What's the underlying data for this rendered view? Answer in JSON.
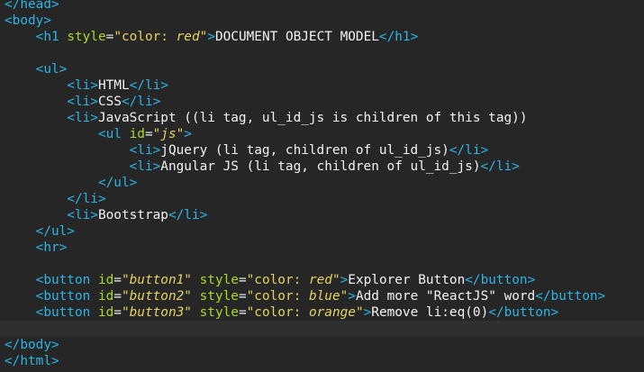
{
  "editor": {
    "colors": {
      "background": "#262626",
      "tag": "#2ab5e6",
      "attribute": "#a8dc24",
      "string": "#e5d35c",
      "text": "#f4f4f4",
      "current_line": "#2f2f2f"
    },
    "lines": [
      {
        "indent": "",
        "parts": [
          {
            "t": "tag",
            "v": "</head>"
          }
        ]
      },
      {
        "indent": "",
        "parts": [
          {
            "t": "tag",
            "v": "<body>"
          }
        ]
      },
      {
        "indent": "    ",
        "parts": [
          {
            "t": "tag",
            "v": "<h1 "
          },
          {
            "t": "attr",
            "v": "style"
          },
          {
            "t": "txt",
            "v": "="
          },
          {
            "t": "val",
            "v": "\"color: "
          },
          {
            "t": "valtext",
            "v": "red"
          },
          {
            "t": "val",
            "v": "\""
          },
          {
            "t": "tag",
            "v": ">"
          },
          {
            "t": "txt",
            "v": "DOCUMENT OBJECT MODEL"
          },
          {
            "t": "tag",
            "v": "</h1>"
          }
        ]
      },
      {
        "indent": "",
        "parts": []
      },
      {
        "indent": "    ",
        "parts": [
          {
            "t": "tag",
            "v": "<ul>"
          }
        ]
      },
      {
        "indent": "        ",
        "parts": [
          {
            "t": "tag",
            "v": "<li>"
          },
          {
            "t": "txt",
            "v": "HTML"
          },
          {
            "t": "tag",
            "v": "</li>"
          }
        ]
      },
      {
        "indent": "        ",
        "parts": [
          {
            "t": "tag",
            "v": "<li>"
          },
          {
            "t": "txt",
            "v": "CSS"
          },
          {
            "t": "tag",
            "v": "</li>"
          }
        ]
      },
      {
        "indent": "        ",
        "parts": [
          {
            "t": "tag",
            "v": "<li>"
          },
          {
            "t": "txt",
            "v": "JavaScript ((li tag, ul_id_js is children of this tag))"
          }
        ]
      },
      {
        "indent": "            ",
        "parts": [
          {
            "t": "tag",
            "v": "<ul "
          },
          {
            "t": "attr",
            "v": "id"
          },
          {
            "t": "txt",
            "v": "="
          },
          {
            "t": "val",
            "v": "\""
          },
          {
            "t": "valtext",
            "v": "js"
          },
          {
            "t": "val",
            "v": "\""
          },
          {
            "t": "tag",
            "v": ">"
          }
        ]
      },
      {
        "indent": "                ",
        "parts": [
          {
            "t": "tag",
            "v": "<li>"
          },
          {
            "t": "txt",
            "v": "jQuery (li tag, children of ul_id_js)"
          },
          {
            "t": "tag",
            "v": "</li>"
          }
        ]
      },
      {
        "indent": "                ",
        "parts": [
          {
            "t": "tag",
            "v": "<li>"
          },
          {
            "t": "txt",
            "v": "Angular JS (li tag, children of ul_id_js)"
          },
          {
            "t": "tag",
            "v": "</li>"
          }
        ]
      },
      {
        "indent": "            ",
        "parts": [
          {
            "t": "tag",
            "v": "</ul>"
          }
        ]
      },
      {
        "indent": "        ",
        "parts": [
          {
            "t": "tag",
            "v": "</li>"
          }
        ]
      },
      {
        "indent": "        ",
        "parts": [
          {
            "t": "tag",
            "v": "<li>"
          },
          {
            "t": "txt",
            "v": "Bootstrap"
          },
          {
            "t": "tag",
            "v": "</li>"
          }
        ]
      },
      {
        "indent": "    ",
        "parts": [
          {
            "t": "tag",
            "v": "</ul>"
          }
        ]
      },
      {
        "indent": "    ",
        "parts": [
          {
            "t": "tag",
            "v": "<hr>"
          }
        ]
      },
      {
        "indent": "",
        "parts": []
      },
      {
        "indent": "    ",
        "parts": [
          {
            "t": "tag",
            "v": "<button "
          },
          {
            "t": "attr",
            "v": "id"
          },
          {
            "t": "txt",
            "v": "="
          },
          {
            "t": "val",
            "v": "\""
          },
          {
            "t": "valtext",
            "v": "button1"
          },
          {
            "t": "val",
            "v": "\""
          },
          {
            "t": "txt",
            "v": " "
          },
          {
            "t": "attr",
            "v": "style"
          },
          {
            "t": "txt",
            "v": "="
          },
          {
            "t": "val",
            "v": "\"color: "
          },
          {
            "t": "valtext",
            "v": "red"
          },
          {
            "t": "val",
            "v": "\""
          },
          {
            "t": "tag",
            "v": ">"
          },
          {
            "t": "txt",
            "v": "Explorer Button"
          },
          {
            "t": "tag",
            "v": "</button>"
          }
        ]
      },
      {
        "indent": "    ",
        "parts": [
          {
            "t": "tag",
            "v": "<button "
          },
          {
            "t": "attr",
            "v": "id"
          },
          {
            "t": "txt",
            "v": "="
          },
          {
            "t": "val",
            "v": "\""
          },
          {
            "t": "valtext",
            "v": "button2"
          },
          {
            "t": "val",
            "v": "\""
          },
          {
            "t": "txt",
            "v": " "
          },
          {
            "t": "attr",
            "v": "style"
          },
          {
            "t": "txt",
            "v": "="
          },
          {
            "t": "val",
            "v": "\"color: "
          },
          {
            "t": "valtext",
            "v": "blue"
          },
          {
            "t": "val",
            "v": "\""
          },
          {
            "t": "tag",
            "v": ">"
          },
          {
            "t": "txt",
            "v": "Add more \"ReactJS\" word"
          },
          {
            "t": "tag",
            "v": "</button>"
          }
        ]
      },
      {
        "indent": "    ",
        "parts": [
          {
            "t": "tag",
            "v": "<button "
          },
          {
            "t": "attr",
            "v": "id"
          },
          {
            "t": "txt",
            "v": "="
          },
          {
            "t": "val",
            "v": "\""
          },
          {
            "t": "valtext",
            "v": "button3"
          },
          {
            "t": "val",
            "v": "\""
          },
          {
            "t": "txt",
            "v": " "
          },
          {
            "t": "attr",
            "v": "style"
          },
          {
            "t": "txt",
            "v": "="
          },
          {
            "t": "val",
            "v": "\"color: "
          },
          {
            "t": "valtext",
            "v": "orange"
          },
          {
            "t": "val",
            "v": "\""
          },
          {
            "t": "tag",
            "v": ">"
          },
          {
            "t": "txt",
            "v": "Remove li:eq(0)"
          },
          {
            "t": "tag",
            "v": "</button>"
          }
        ]
      },
      {
        "indent": "",
        "parts": []
      },
      {
        "indent": "",
        "parts": [
          {
            "t": "tag",
            "v": "</body>"
          }
        ]
      },
      {
        "indent": "",
        "parts": [
          {
            "t": "tag",
            "v": "</html>"
          }
        ]
      }
    ],
    "current_line": 20
  }
}
